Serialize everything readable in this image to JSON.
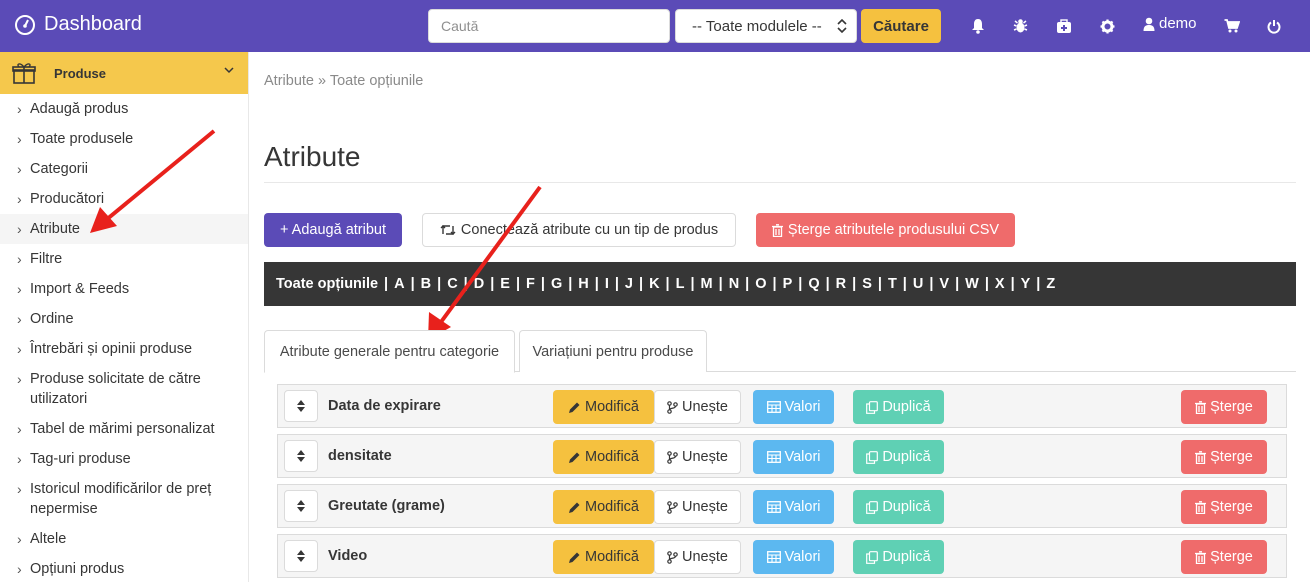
{
  "header": {
    "brand": "Dashboard",
    "search_placeholder": "Caută",
    "module_select": "-- Toate modulele --",
    "search_button": "Căutare",
    "user": "demo"
  },
  "sidebar": {
    "section": "Produse",
    "items": [
      {
        "label": "Adaugă produs"
      },
      {
        "label": "Toate produsele"
      },
      {
        "label": "Categorii"
      },
      {
        "label": "Producători"
      },
      {
        "label": "Atribute"
      },
      {
        "label": "Filtre"
      },
      {
        "label": "Import & Feeds"
      },
      {
        "label": "Ordine"
      },
      {
        "label": "Întrebări și opinii produse"
      },
      {
        "label": "Produse solicitate de către utilizatori"
      },
      {
        "label": "Tabel de mărimi personalizat"
      },
      {
        "label": "Tag-uri produse"
      },
      {
        "label": "Istoricul modificărilor de preț nepermise"
      },
      {
        "label": "Altele"
      },
      {
        "label": "Opțiuni produs"
      }
    ]
  },
  "breadcrumb": "Atribute » Toate opțiunile",
  "page_title": "Atribute",
  "actions": {
    "add": "+ Adaugă atribut",
    "connect": "Conectează atribute cu un tip de produs",
    "delete_csv": "Șterge atributele produsului CSV"
  },
  "alphabet": {
    "all": "Toate opțiunile",
    "letters": [
      "A",
      "B",
      "C",
      "D",
      "E",
      "F",
      "G",
      "H",
      "I",
      "J",
      "K",
      "L",
      "M",
      "N",
      "O",
      "P",
      "Q",
      "R",
      "S",
      "T",
      "U",
      "V",
      "W",
      "X",
      "Y",
      "Z"
    ]
  },
  "tabs": {
    "general": "Atribute generale pentru categorie",
    "variants": "Variațiuni pentru produse"
  },
  "row_buttons": {
    "edit": "Modifică",
    "merge": "Unește",
    "values": "Valori",
    "duplicate": "Duplică",
    "delete": "Șterge"
  },
  "attributes": [
    {
      "name": "Data de expirare"
    },
    {
      "name": "densitate"
    },
    {
      "name": "Greutate (grame)"
    },
    {
      "name": "Video"
    }
  ],
  "colors": {
    "brand": "#5b4bb7",
    "accent_yellow": "#f5c13f",
    "danger": "#ef6b6b",
    "info": "#5cb8f0",
    "success": "#5fd0b4",
    "annotation_arrow": "#e8211c"
  }
}
